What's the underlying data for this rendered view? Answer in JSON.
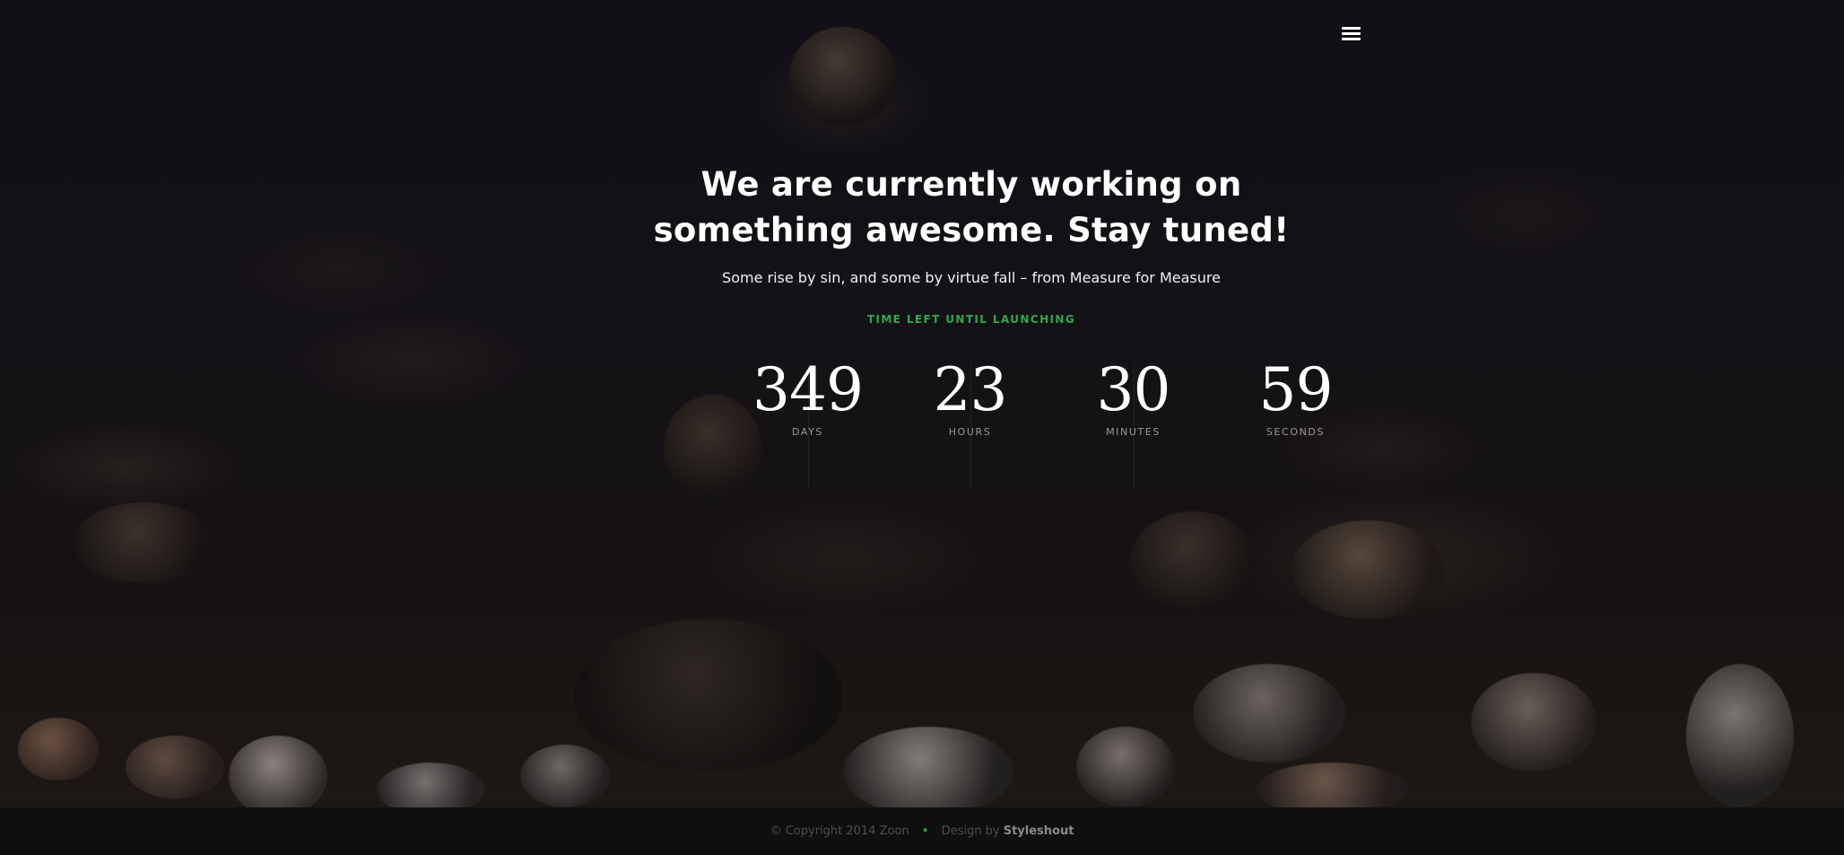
{
  "header": {
    "menu_icon": "hamburger-menu-icon"
  },
  "hero": {
    "headline_line1": "We are currently working on",
    "headline_line2": "something awesome. Stay tuned!",
    "subtitle": "Some rise by sin, and some by virtue fall – from Measure for Measure",
    "time_label": "TIME LEFT UNTIL LAUNCHING"
  },
  "countdown": [
    {
      "value": "349",
      "unit": "DAYS"
    },
    {
      "value": "23",
      "unit": "HOURS"
    },
    {
      "value": "30",
      "unit": "MINUTES"
    },
    {
      "value": "59",
      "unit": "SECONDS"
    }
  ],
  "footer": {
    "copyright": "© Copyright 2014 Zoon",
    "separator": "•",
    "design_prefix": "Design by",
    "design_brand": "Styleshout"
  },
  "colors": {
    "accent": "#2fa84f",
    "text": "#ffffff",
    "footer_bg": "#0f0f10"
  }
}
